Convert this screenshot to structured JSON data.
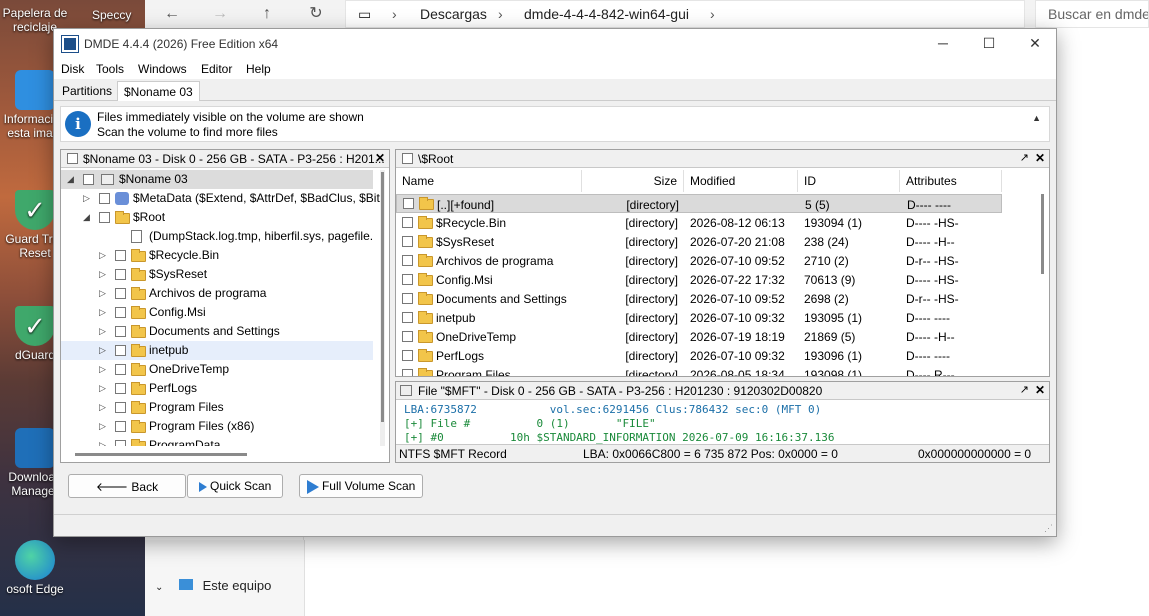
{
  "desktop": {
    "icons": [
      {
        "label": "Papelera de reciclaje",
        "icon": "recycle-bin-icon"
      },
      {
        "label": "Información esta ima...",
        "icon": "image-info-icon"
      },
      {
        "label": "Guard Trial Reset",
        "icon": "shield-check-icon"
      },
      {
        "label": "dGuard",
        "icon": "shield-check-icon"
      },
      {
        "label": "Download Manager",
        "icon": "download-manager-icon"
      },
      {
        "label": "osoft Edge",
        "icon": "edge-icon"
      }
    ],
    "speccy_label": "Speccy"
  },
  "explorer": {
    "breadcrumb": [
      "Descargas",
      "dmde-4-4-4-842-win64-gui"
    ],
    "search_placeholder": "Buscar en dmde-",
    "nav_item": "Este equipo"
  },
  "window": {
    "title": "DMDE 4.4.4 (2026) Free Edition x64",
    "menu": [
      "Disk",
      "Tools",
      "Windows",
      "Editor",
      "Help"
    ],
    "tabs": [
      "Partitions",
      "$Noname 03"
    ],
    "info_line1": "Files immediately visible on the volume are shown",
    "info_line2": "Scan the volume to find more files"
  },
  "tree_pane": {
    "title": "$Noname 03 - Disk 0 - 256 GB - SATA - P3-256 : H201...",
    "rows": [
      {
        "label": "$Noname 03"
      },
      {
        "label": "$MetaData ($Extend, $AttrDef, $BadClus, $Bitm"
      },
      {
        "label": "$Root"
      },
      {
        "label": "(DumpStack.log.tmp, hiberfil.sys, pagefile."
      },
      {
        "label": "$Recycle.Bin"
      },
      {
        "label": "$SysReset"
      },
      {
        "label": "Archivos de programa"
      },
      {
        "label": "Config.Msi"
      },
      {
        "label": "Documents and Settings"
      },
      {
        "label": "inetpub"
      },
      {
        "label": "OneDriveTemp"
      },
      {
        "label": "PerfLogs"
      },
      {
        "label": "Program Files"
      },
      {
        "label": "Program Files (x86)"
      },
      {
        "label": "ProgramData"
      }
    ]
  },
  "list_pane": {
    "title": "\\$Root",
    "columns": [
      "Name",
      "Size",
      "Modified",
      "ID",
      "Attributes"
    ],
    "rows": [
      {
        "name": "[..][+found]",
        "size": "[directory]",
        "modified": "",
        "id": "5 (5)",
        "attr": "D---- ----"
      },
      {
        "name": "$Recycle.Bin",
        "size": "[directory]",
        "modified": "2026-08-12 06:13",
        "id": "193094 (1)",
        "attr": "D---- -HS-"
      },
      {
        "name": "$SysReset",
        "size": "[directory]",
        "modified": "2026-07-20 21:08",
        "id": "238 (24)",
        "attr": "D---- -H--"
      },
      {
        "name": "Archivos de programa",
        "size": "[directory]",
        "modified": "2026-07-10 09:52",
        "id": "2710 (2)",
        "attr": "D-r-- -HS-"
      },
      {
        "name": "Config.Msi",
        "size": "[directory]",
        "modified": "2026-07-22 17:32",
        "id": "70613 (9)",
        "attr": "D---- -HS-"
      },
      {
        "name": "Documents and Settings",
        "size": "[directory]",
        "modified": "2026-07-10 09:52",
        "id": "2698 (2)",
        "attr": "D-r-- -HS-"
      },
      {
        "name": "inetpub",
        "size": "[directory]",
        "modified": "2026-07-10 09:32",
        "id": "193095 (1)",
        "attr": "D---- ----"
      },
      {
        "name": "OneDriveTemp",
        "size": "[directory]",
        "modified": "2026-07-19 18:19",
        "id": "21869 (5)",
        "attr": "D---- -H--"
      },
      {
        "name": "PerfLogs",
        "size": "[directory]",
        "modified": "2026-07-10 09:32",
        "id": "193096 (1)",
        "attr": "D---- ----"
      },
      {
        "name": "Program Files",
        "size": "[directory]",
        "modified": "2026-08-05 18:34",
        "id": "193098 (1)",
        "attr": "D---- R---"
      }
    ]
  },
  "hex_pane": {
    "title": "File \"$MFT\" - Disk 0 - 256 GB - SATA - P3-256 : H201230 : 9120302D00820",
    "line1": "LBA:6735872           vol.sec:6291456 Clus:786432 sec:0 (MFT 0)",
    "line2": "[+] File #          0 (1)       \"FILE\"",
    "line3": "[+] #0          10h $STANDARD_INFORMATION 2026-07-09 16:16:37.136",
    "status_left": "NTFS $MFT Record",
    "status_mid": "LBA: 0x0066C800 = 6 735 872  Pos: 0x0000 = 0",
    "status_right": "0x000000000000 = 0"
  },
  "buttons": {
    "back": "Back",
    "quick_scan": "Quick Scan",
    "full_scan": "Full Volume Scan"
  },
  "colors": {
    "accent": "#1a6fc2",
    "folder": "#f2c54a"
  }
}
